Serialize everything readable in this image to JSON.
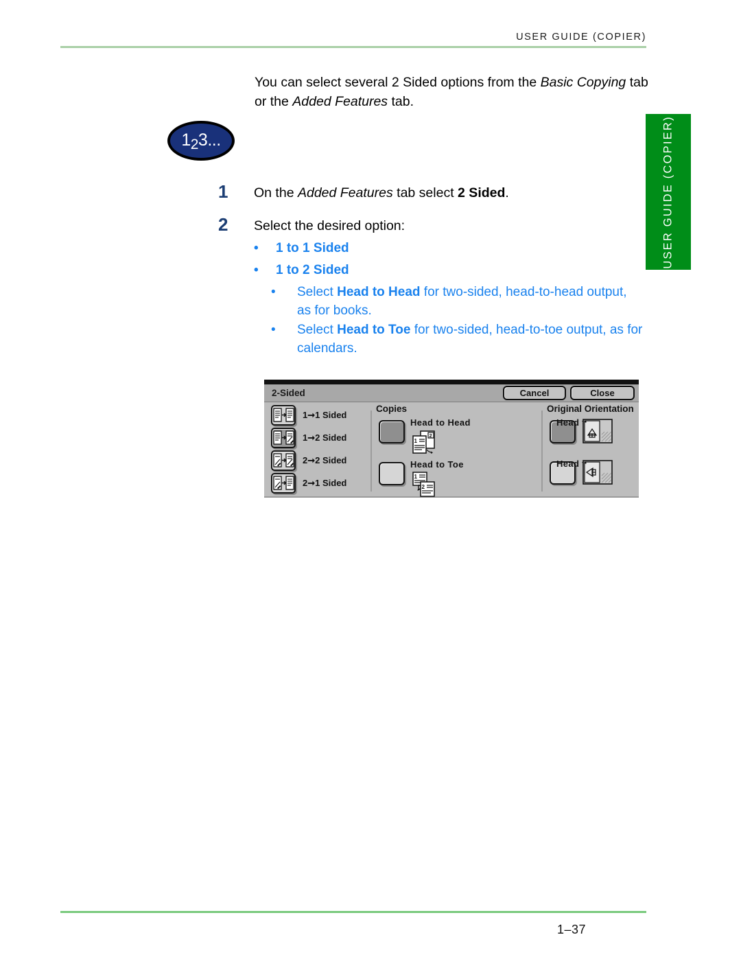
{
  "header": {
    "title": "User Guide (Copier)",
    "rule_color": "#a9cfa6"
  },
  "side_tab": {
    "label": "USER GUIDE (COPIER)",
    "color": "#008d18"
  },
  "intro": {
    "text_1": "You can select several 2 Sided options from the ",
    "em_1": "Basic Copying",
    "text_2": " tab or the ",
    "em_2": "Added Features",
    "text_3": " tab."
  },
  "badge": {
    "digit_1": "1",
    "digit_2": "2",
    "digit_3": "3",
    "dots": "..."
  },
  "steps": [
    {
      "number": "1",
      "text_1": "On the ",
      "em_1": "Added Features",
      "text_2": " tab select ",
      "strong_1": "2 Sided",
      "text_3": "."
    },
    {
      "number": "2",
      "text_1": "Select the desired option:"
    }
  ],
  "options": {
    "bullet_char": "•",
    "level1": [
      {
        "label": "1 to 1 Sided"
      },
      {
        "label": "1 to 2 Sided"
      }
    ],
    "level2": [
      {
        "text_1": "Select ",
        "strong_1": "Head to Head",
        "text_2": " for two-sided, head-to-head output, as for books."
      },
      {
        "text_1": "Select ",
        "strong_1": "Head to Toe",
        "text_2": " for two-sided, head-to-toe output, as for calendars."
      }
    ],
    "accent_color": "#1a82ee"
  },
  "dialog": {
    "title": "2-Sided",
    "buttons": {
      "cancel": "Cancel",
      "close": "Close"
    },
    "sided_options": [
      {
        "label": "1➞1 Sided",
        "selected": false,
        "icon": "one-to-one-sided-icon"
      },
      {
        "label": "1➞2 Sided",
        "selected": true,
        "icon": "one-to-two-sided-icon"
      },
      {
        "label": "2➞2 Sided",
        "selected": false,
        "icon": "two-to-two-sided-icon"
      },
      {
        "label": "2➞1 Sided",
        "selected": false,
        "icon": "two-to-one-sided-icon"
      }
    ],
    "copies": {
      "heading": "Copies",
      "items": [
        {
          "label": "Head to Head",
          "selected": true,
          "icon": "head-to-head-icon"
        },
        {
          "label": "Head to Toe",
          "selected": false,
          "icon": "head-to-toe-icon"
        }
      ]
    },
    "original_orientation": {
      "heading": "Original Orientation",
      "items": [
        {
          "label": "Head to Top",
          "selected": true,
          "icon": "head-to-top-icon"
        },
        {
          "label": "Head to Left",
          "selected": false,
          "icon": "head-to-left-icon"
        }
      ]
    }
  },
  "footer": {
    "page_number": "1–37",
    "rule_color": "#78c97c"
  }
}
